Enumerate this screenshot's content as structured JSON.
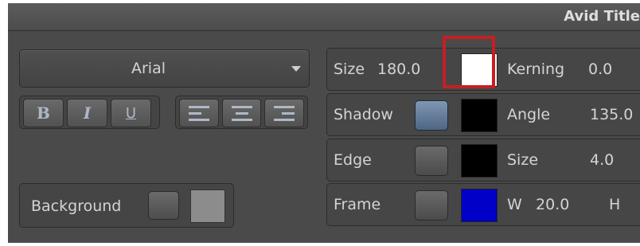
{
  "title": "Avid Title",
  "font": {
    "family": "Arial"
  },
  "format_buttons": [
    {
      "name": "bold-button",
      "label": "B"
    },
    {
      "name": "italic-button",
      "label": "I"
    },
    {
      "name": "underline-button",
      "label": "U"
    }
  ],
  "align_buttons": [
    "align-left-icon",
    "align-center-icon",
    "align-right-icon"
  ],
  "background": {
    "label": "Background",
    "swatch_color": "#8c8c8c",
    "enabled": false
  },
  "size_row": {
    "label": "Size",
    "value": "180.0",
    "color": "#ffffff",
    "kerning_label": "Kerning",
    "kerning_value": "0.0"
  },
  "shadow_row": {
    "label": "Shadow",
    "enabled": true,
    "color": "#000000",
    "angle_label": "Angle",
    "angle_value": "135.0"
  },
  "edge_row": {
    "label": "Edge",
    "enabled": false,
    "color": "#000000",
    "size_label": "Size",
    "size_value": "4.0"
  },
  "frame_row": {
    "label": "Frame",
    "enabled": false,
    "color": "#0000c8",
    "w_label": "W",
    "w_value": "20.0",
    "h_label": "H"
  },
  "highlight_color": "#c51f24"
}
